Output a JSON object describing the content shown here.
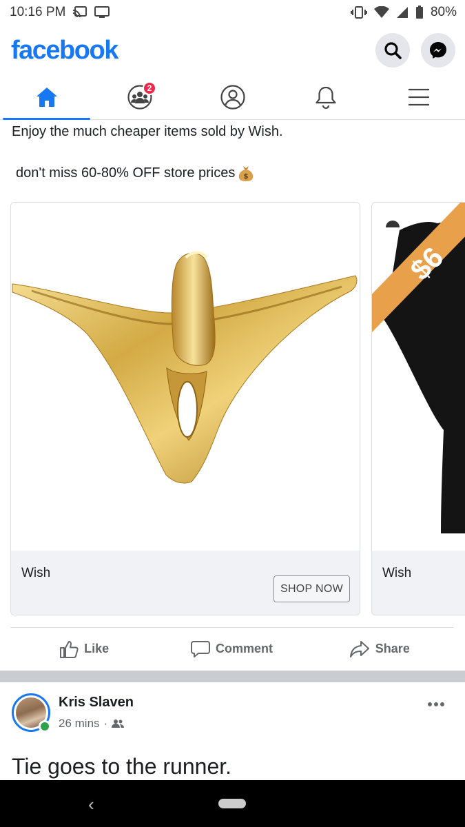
{
  "status_bar": {
    "time": "10:16 PM",
    "battery": "80%",
    "icons": [
      "cast-icon",
      "screen-icon",
      "vibrate-icon",
      "wifi-icon",
      "signal-icon",
      "battery-icon"
    ]
  },
  "header": {
    "logo": "facebook",
    "actions": [
      "search-icon",
      "messenger-icon"
    ]
  },
  "tabs": [
    {
      "name": "home",
      "icon": "home-icon",
      "active": true
    },
    {
      "name": "groups",
      "icon": "groups-icon",
      "badge": "2"
    },
    {
      "name": "profile",
      "icon": "profile-icon"
    },
    {
      "name": "notifications",
      "icon": "bell-icon"
    },
    {
      "name": "menu",
      "icon": "menu-icon"
    }
  ],
  "ad_post": {
    "text_line_1": "Enjoy the much cheaper items sold by Wish.",
    "text_line_2": "don't miss 60-80% OFF store prices",
    "carousel": [
      {
        "brand": "Wish",
        "button": "SHOP NOW",
        "image": "gold-underwear-product"
      },
      {
        "brand": "Wish",
        "price_banner": "$6",
        "image": "black-tshirt-product"
      }
    ],
    "actions": {
      "like": "Like",
      "comment": "Comment",
      "share": "Share"
    }
  },
  "next_post": {
    "author": "Kris Slaven",
    "time": "26 mins",
    "audience_icon": "friends-icon",
    "body": "Tie goes to the runner."
  },
  "colors": {
    "brand_blue": "#1877f2",
    "badge_red": "#f02849",
    "price_banner": "#e8a04a",
    "online_green": "#31a24c"
  }
}
